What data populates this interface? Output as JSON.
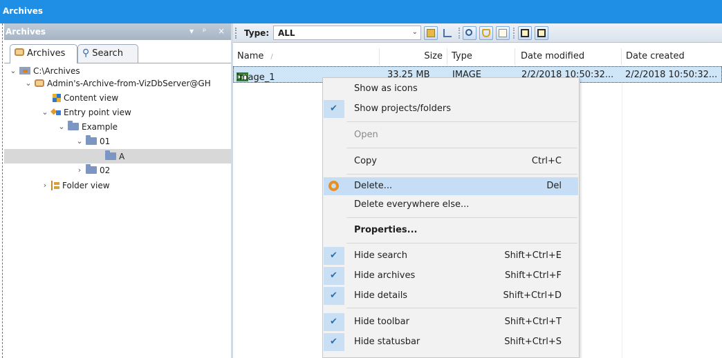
{
  "window": {
    "title": "Archives"
  },
  "left_pane": {
    "title": "Archives",
    "controls": [
      "▾",
      "ᵖ",
      "×"
    ],
    "tabs": [
      {
        "label": "Archives",
        "icon": "archive-icon",
        "active": true
      },
      {
        "label": "Search",
        "icon": "search-icon",
        "active": false
      }
    ],
    "tree": [
      {
        "label": "C:\\Archives",
        "icon": "drive-icon",
        "expanded": true
      },
      {
        "label": "Admin's-Archive-from-VizDbServer@GH",
        "icon": "archive-icon",
        "expanded": true
      },
      {
        "label": "Content view",
        "icon": "content-view-icon"
      },
      {
        "label": "Entry point view",
        "icon": "entry-point-icon",
        "expanded": true
      },
      {
        "label": "Example",
        "icon": "folder-icon",
        "expanded": true
      },
      {
        "label": "01",
        "icon": "folder-icon",
        "expanded": true
      },
      {
        "label": "A",
        "icon": "folder-icon",
        "selected": true
      },
      {
        "label": "02",
        "icon": "folder-icon",
        "expanded": false
      },
      {
        "label": "Folder view",
        "icon": "folder-view-icon",
        "expanded": false
      }
    ]
  },
  "toolbar": {
    "type_label": "Type:",
    "type_value": "ALL"
  },
  "columns": {
    "name": "Name",
    "size": "Size",
    "type": "Type",
    "date_modified": "Date modified",
    "date_created": "Date created"
  },
  "rows": [
    {
      "name": "Image_1",
      "size": "33.25 MB",
      "type": "IMAGE",
      "date_modified": "2/2/2018 10:50:32...",
      "date_created": "2/2/2018 10:50:32..."
    }
  ],
  "context_menu": {
    "items": [
      {
        "label": "Show as icons",
        "shortcut": "",
        "checked": false
      },
      {
        "label": "Show projects/folders",
        "shortcut": "",
        "checked": true
      },
      {
        "label": "Open",
        "shortcut": "",
        "disabled": true
      },
      {
        "label": "Copy",
        "shortcut": "Ctrl+C"
      },
      {
        "label": "Delete...",
        "shortcut": "Del",
        "highlighted": true,
        "icon": "delete-icon"
      },
      {
        "label": "Delete everywhere else...",
        "shortcut": ""
      },
      {
        "label": "Properties...",
        "shortcut": "",
        "bold": true
      },
      {
        "label": "Hide search",
        "shortcut": "Shift+Ctrl+E",
        "checked": true
      },
      {
        "label": "Hide archives",
        "shortcut": "Shift+Ctrl+F",
        "checked": true
      },
      {
        "label": "Hide details",
        "shortcut": "Shift+Ctrl+D",
        "checked": true
      },
      {
        "label": "Hide toolbar",
        "shortcut": "Shift+Ctrl+T",
        "checked": true
      },
      {
        "label": "Hide statusbar",
        "shortcut": "Shift+Ctrl+S",
        "checked": true
      }
    ]
  },
  "colors": {
    "title_bar": "#1f8fe6",
    "selection": "#cfe5f8",
    "menu_highlight": "#c5def5"
  }
}
